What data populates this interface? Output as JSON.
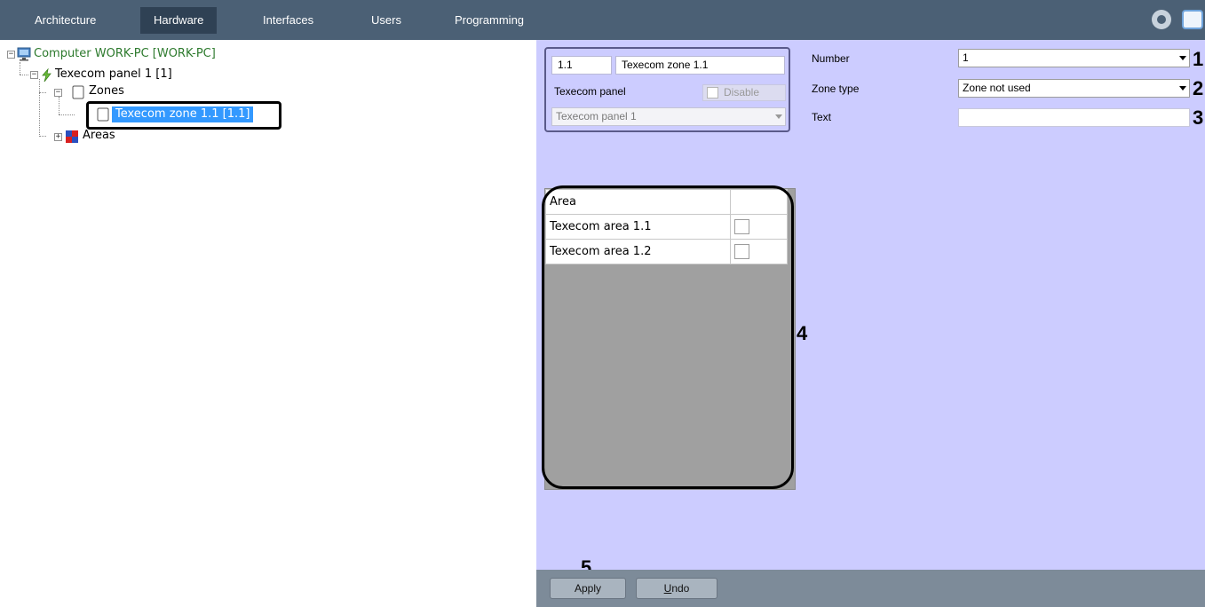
{
  "toolbar": {
    "tabs": [
      {
        "label": "Architecture",
        "active": false
      },
      {
        "label": "Hardware",
        "active": true
      },
      {
        "label": "Interfaces",
        "active": false
      },
      {
        "label": "Users",
        "active": false
      },
      {
        "label": "Programming",
        "active": false
      }
    ],
    "background_color": "#4b6075"
  },
  "tree": {
    "computer": "Computer WORK-PC [WORK-PC]",
    "panel": "Texecom panel 1 [1]",
    "zones": "Zones",
    "zone": "Texecom zone 1.1 [1.1]",
    "areas": "Areas",
    "computer_color": "#2d7a2d",
    "selected_color": "#3399ff"
  },
  "object_header": {
    "id_value": "1.1",
    "name_value": "Texecom zone 1.1",
    "parent_label": "Texecom panel",
    "disable_label": "Disable",
    "parent_select_value": "Texecom panel 1"
  },
  "settings": {
    "number_label": "Number",
    "number_value": "1",
    "zone_type_label": "Zone type",
    "zone_type_value": "Zone not used",
    "text_label": "Text",
    "text_value": ""
  },
  "areas_table": {
    "header": "Area",
    "rows": [
      {
        "name": "Texecom area 1.1",
        "checked": false
      },
      {
        "name": "Texecom area 1.2",
        "checked": false
      }
    ]
  },
  "buttons": {
    "apply": "Apply",
    "undo_prefix": "U",
    "undo_rest": "ndo"
  },
  "callouts": [
    "1",
    "2",
    "3",
    "4",
    "5"
  ],
  "icons": {
    "computer": "monitor-icon",
    "panel": "panel-icon",
    "zone": "zone-icon",
    "areas": "areas-icon",
    "settings": "gear-icon"
  },
  "colors": {
    "panel_bg": "#ccccff",
    "bottom_bar": "#7d8b99"
  }
}
